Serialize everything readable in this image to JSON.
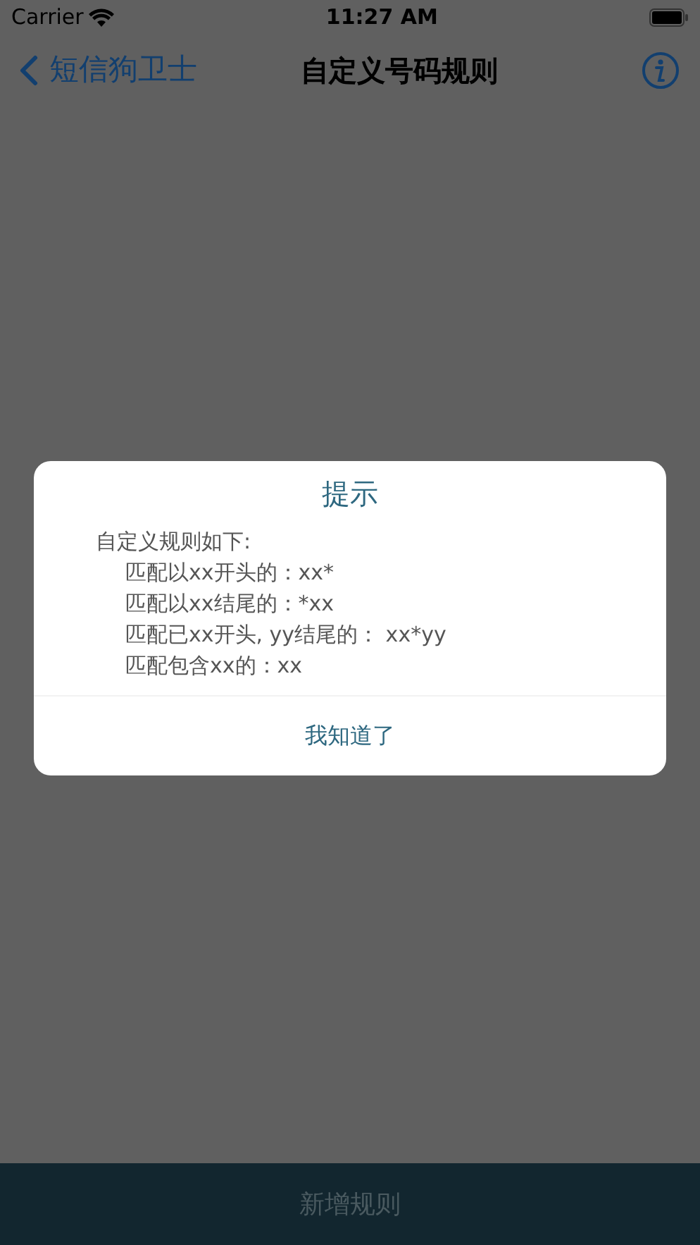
{
  "status_bar": {
    "carrier": "Carrier",
    "time": "11:27 AM"
  },
  "nav": {
    "back_label": "短信狗卫士",
    "title": "自定义号码规则"
  },
  "alert": {
    "title": "提示",
    "message": {
      "heading": "自定义规则如下:",
      "items": [
        "匹配以xx开头的：xx*",
        "匹配以xx结尾的：*xx",
        "匹配已xx开头, yy结尾的：  xx*yy",
        "匹配包含xx的：xx"
      ]
    },
    "button": "我知道了"
  },
  "bottom_button": {
    "label": "新增规则",
    "disabled": true
  }
}
